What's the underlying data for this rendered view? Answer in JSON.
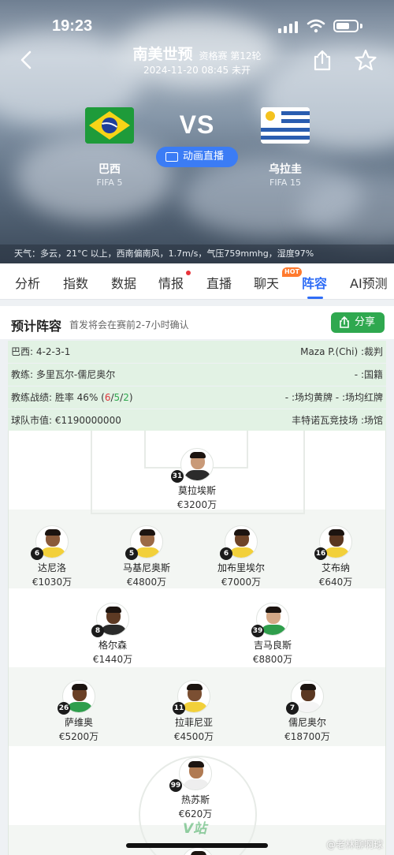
{
  "status_bar": {
    "time": "19:23"
  },
  "header": {
    "title": "南美世预",
    "subtitle": "资格赛 第12轮",
    "datetime": "2024-11-20 08:45 未开",
    "vs": "VS",
    "animation_button": "动画直播",
    "home": {
      "name": "巴西",
      "rank": "FIFA 5"
    },
    "away": {
      "name": "乌拉圭",
      "rank": "FIFA 15"
    },
    "weather": "天气：多云，21°C 以上，西南偏南风，1.7m/s，气压759mmhg，湿度97%"
  },
  "tabs": [
    {
      "label": "分析"
    },
    {
      "label": "指数"
    },
    {
      "label": "数据"
    },
    {
      "label": "情报"
    },
    {
      "label": "直播"
    },
    {
      "label": "聊天"
    },
    {
      "label": "阵容"
    },
    {
      "label": "AI预测"
    }
  ],
  "tab_badges": {
    "hot": "HOT"
  },
  "lineup": {
    "title": "预计阵容",
    "note": "首发将会在赛前2-7小时确认",
    "share_label": "分享",
    "info_rows": [
      {
        "left": "巴西: 4-2-3-1",
        "right": "Maza P.(Chi) :裁判"
      },
      {
        "left": "教练: 多里瓦尔-儒尼奥尔",
        "right": "- :国籍"
      },
      {
        "left_prefix": "教练战绩: 胜率 46%  (",
        "w": "6",
        "sep1": "/",
        "d": "5",
        "sep2": "/",
        "l": "2",
        "left_suffix": ")",
        "right": "- :场均黄牌 - :场均红牌"
      },
      {
        "left": "球队市值: €1190000000",
        "right": "丰特诺瓦竞技场 :场馆"
      }
    ],
    "players": [
      {
        "number": "31",
        "name": "莫拉埃斯",
        "value": "€3200万"
      },
      {
        "number": "6",
        "name": "达尼洛",
        "value": "€1030万"
      },
      {
        "number": "5",
        "name": "马基尼奥斯",
        "value": "€4800万"
      },
      {
        "number": "6",
        "name": "加布里埃尔",
        "value": "€7000万"
      },
      {
        "number": "16",
        "name": "艾布纳",
        "value": "€640万"
      },
      {
        "number": "8",
        "name": "格尔森",
        "value": "€1440万"
      },
      {
        "number": "39",
        "name": "吉马良斯",
        "value": "€8800万"
      },
      {
        "number": "26",
        "name": "萨维奥",
        "value": "€5200万"
      },
      {
        "number": "11",
        "name": "拉菲尼亚",
        "value": "€4500万"
      },
      {
        "number": "7",
        "name": "儒尼奥尔",
        "value": "€18700万"
      },
      {
        "number": "99",
        "name": "热苏斯",
        "value": "€620万"
      }
    ]
  },
  "watermarks": {
    "site": "V站",
    "account": "@老林聊啊球"
  },
  "colors": {
    "accent": "#2f6df6",
    "share": "#2fa84f",
    "info_bg": "#e2f2e4",
    "loss": "#e0343c",
    "draw": "#2fa84f"
  }
}
